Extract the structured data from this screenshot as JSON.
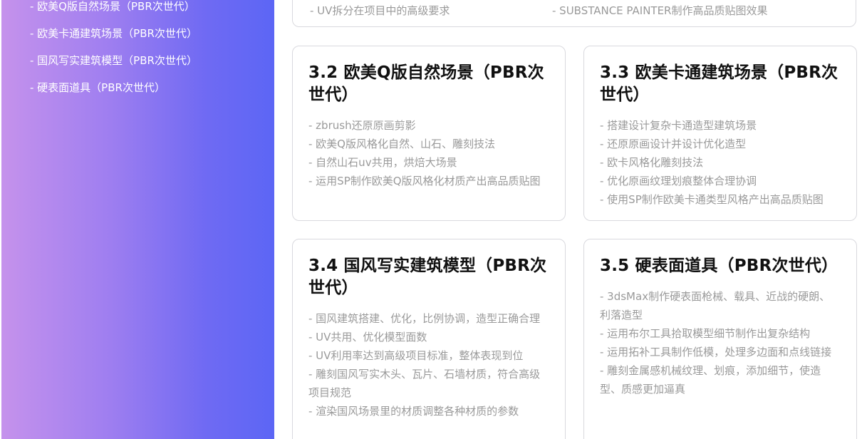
{
  "sidebar": {
    "items": [
      {
        "label": "- 欧美Q版自然场景（PBR次世代）"
      },
      {
        "label": "- 欧美卡通建筑场景（PBR次世代）"
      },
      {
        "label": "- 国风写实建筑模型（PBR次世代）"
      },
      {
        "label": "- 硬表面道具（PBR次世代）"
      }
    ]
  },
  "top_card": {
    "col1": "-  UV拆分在项目中的高级要求",
    "col2": "-  SUBSTANCE PAINTER制作高品质贴图效果"
  },
  "cards": [
    {
      "title": "3.2 欧美Q版自然场景（PBR次世代）",
      "items": [
        "-  zbrush还原原画剪影",
        "-  欧美Q版风格化自然、山石、雕刻技法",
        "-  自然山石uv共用，烘焙大场景",
        "-  运用SP制作欧美Q版风格化材质产出高品质贴图"
      ]
    },
    {
      "title": "3.3 欧美卡通建筑场景（PBR次世代）",
      "items": [
        "-  搭建设计复杂卡通造型建筑场景",
        "-  还原原画设计并设计优化造型",
        "-  欧卡风格化雕刻技法",
        "-  优化原画纹理划痕整体合理协调",
        "-  使用SP制作欧美卡通类型风格产出高品质贴图"
      ]
    },
    {
      "title": "3.4 国风写实建筑模型（PBR次世代）",
      "items": [
        "-  国风建筑搭建、优化，比例协调，造型正确合理",
        "-  UV共用、优化模型面数",
        "-  UV利用率达到高级项目标准，整体表现到位",
        "-  雕刻国风写实木头、瓦片、石墙材质，符合高级项目规范",
        "-  渲染国风场景里的材质调整各种材质的参数"
      ]
    },
    {
      "title": "3.5 硬表面道具（PBR次世代）",
      "items": [
        "-  3dsMax制作硬表面枪械、载具、近战的硬朗、利落造型",
        "-  运用布尔工具拾取模型细节制作出复杂结构",
        "-  运用拓补工具制作低模，处理多边面和点线链接",
        "-  雕刻金属感机械纹理、划痕，添加细节，使造型、质感更加逼真"
      ]
    }
  ]
}
